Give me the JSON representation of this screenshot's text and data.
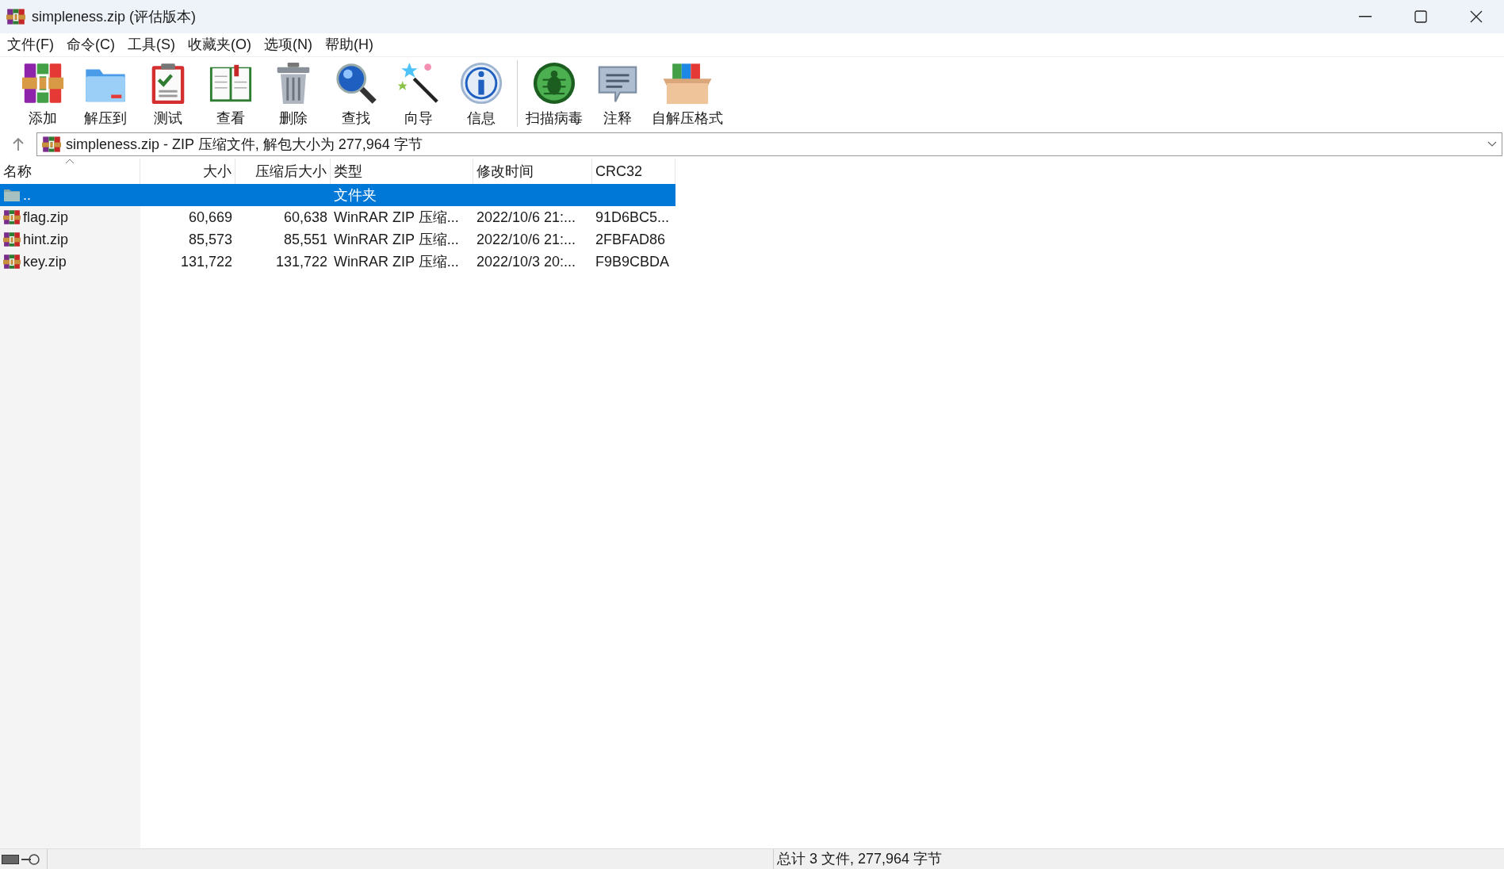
{
  "window": {
    "title": "simpleness.zip (评估版本)"
  },
  "menu": [
    "文件(F)",
    "命令(C)",
    "工具(S)",
    "收藏夹(O)",
    "选项(N)",
    "帮助(H)"
  ],
  "toolbar": [
    [
      {
        "label": "添加"
      },
      {
        "label": "解压到"
      },
      {
        "label": "测试"
      },
      {
        "label": "查看"
      },
      {
        "label": "删除"
      },
      {
        "label": "查找"
      },
      {
        "label": "向导"
      },
      {
        "label": "信息"
      }
    ],
    [
      {
        "label": "扫描病毒"
      },
      {
        "label": "注释"
      },
      {
        "label": "自解压格式"
      }
    ]
  ],
  "address": {
    "value": "simpleness.zip - ZIP 压缩文件, 解包大小为 277,964 字节"
  },
  "table": {
    "columns": [
      {
        "label": "名称",
        "sorted": true
      },
      {
        "label": "大小",
        "sorted": false
      },
      {
        "label": "压缩后大小",
        "sorted": false
      },
      {
        "label": "类型",
        "sorted": false
      },
      {
        "label": "修改时间",
        "sorted": false
      },
      {
        "label": "CRC32",
        "sorted": false
      }
    ],
    "rows": [
      {
        "kind": "folder",
        "selected": true,
        "cells": [
          "..",
          "",
          "",
          "文件夹",
          "",
          ""
        ]
      },
      {
        "kind": "archive",
        "selected": false,
        "cells": [
          "flag.zip",
          "60,669",
          "60,638",
          "WinRAR ZIP 压缩...",
          "2022/10/6 21:...",
          "91D6BC5..."
        ]
      },
      {
        "kind": "archive",
        "selected": false,
        "cells": [
          "hint.zip",
          "85,573",
          "85,551",
          "WinRAR ZIP 压缩...",
          "2022/10/6 21:...",
          "2FBFAD86"
        ]
      },
      {
        "kind": "archive",
        "selected": false,
        "cells": [
          "key.zip",
          "131,722",
          "131,722",
          "WinRAR ZIP 压缩...",
          "2022/10/3 20:...",
          "F9B9CBDA"
        ]
      }
    ]
  },
  "status_bar": {
    "text": "总计 3 文件, 277,964 字节"
  }
}
